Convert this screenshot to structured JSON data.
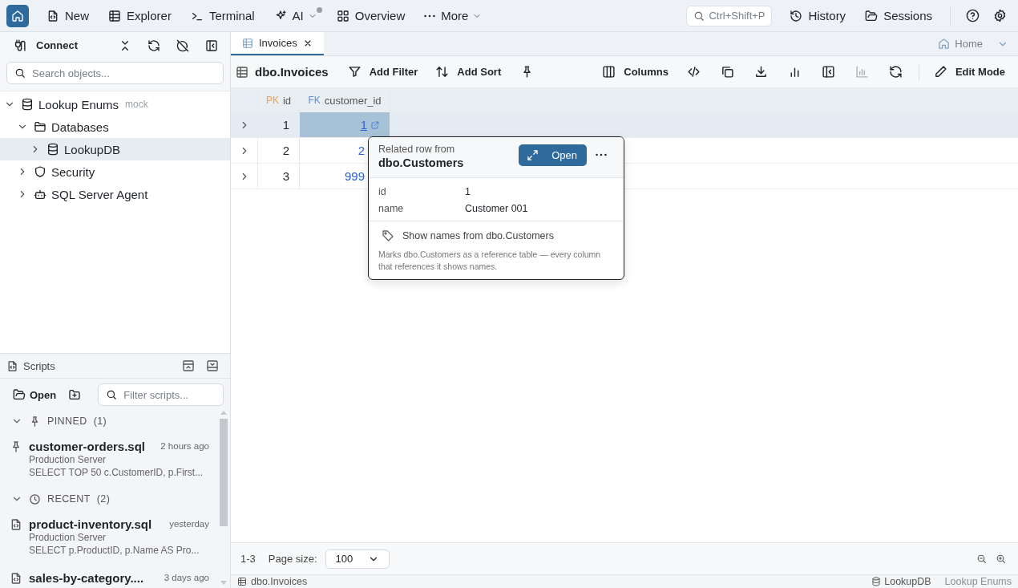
{
  "topbar": {
    "nav": [
      {
        "kind": "new",
        "label": "New",
        "menu": false,
        "notification": false
      },
      {
        "kind": "explorer",
        "label": "Explorer",
        "menu": false,
        "notification": false
      },
      {
        "kind": "terminal",
        "label": "Terminal",
        "menu": false,
        "notification": false
      },
      {
        "kind": "ai",
        "label": "AI",
        "menu": true,
        "notification": true
      },
      {
        "kind": "overview",
        "label": "Overview",
        "menu": false,
        "notification": false
      },
      {
        "kind": "more",
        "label": "More",
        "menu": true,
        "notification": false
      }
    ],
    "command_search": {
      "placeholder": "Ctrl+Shift+P"
    },
    "actions": [
      {
        "kind": "history",
        "label": "History"
      },
      {
        "kind": "sessions",
        "label": "Sessions"
      }
    ]
  },
  "sidebar": {
    "title": "Connect",
    "search": {
      "placeholder": "Search objects..."
    },
    "tree": [
      {
        "kind": "server",
        "label": "Lookup Enums",
        "badge": "mock",
        "expanded": true,
        "selected": false,
        "children": [
          {
            "kind": "folder",
            "label": "Databases",
            "expanded": true,
            "selected": false,
            "children": [
              {
                "kind": "database",
                "label": "LookupDB",
                "expanded": false,
                "selected": true
              }
            ]
          },
          {
            "kind": "security",
            "label": "Security",
            "expanded": false,
            "selected": false
          },
          {
            "kind": "agent",
            "label": "SQL Server Agent",
            "expanded": false,
            "selected": false
          }
        ]
      }
    ]
  },
  "scripts": {
    "title": "Scripts",
    "open_label": "Open",
    "filter": {
      "placeholder": "Filter scripts..."
    },
    "groups": [
      {
        "kind": "pinned",
        "label": "PINNED",
        "count": "(1)",
        "expanded": true,
        "items": [
          {
            "kind": "pinned",
            "name": "customer-orders.sql",
            "time": "2 hours ago",
            "server": "Production Server",
            "query": "SELECT TOP 50 c.CustomerID, p.First..."
          }
        ]
      },
      {
        "kind": "recent",
        "label": "RECENT",
        "count": "(2)",
        "expanded": true,
        "items": [
          {
            "kind": "script",
            "name": "product-inventory.sql",
            "time": "yesterday",
            "server": "Production Server",
            "query": "SELECT p.ProductID, p.Name AS Pro..."
          },
          {
            "kind": "script",
            "name": "sales-by-category....",
            "time": "3 days ago"
          }
        ]
      }
    ]
  },
  "tabs": [
    {
      "label": "Invoices",
      "selected": true
    }
  ],
  "workspace": {
    "label": "Home"
  },
  "toolbar": {
    "table": "dbo.Invoices",
    "actions": [
      {
        "kind": "filter",
        "label": "Add Filter"
      },
      {
        "kind": "sort",
        "label": "Add Sort"
      },
      {
        "kind": "pin"
      }
    ],
    "tools": [
      {
        "kind": "columns",
        "label": "Columns",
        "disabled": false
      },
      {
        "kind": "code",
        "disabled": false
      },
      {
        "kind": "copy",
        "disabled": false
      },
      {
        "kind": "download",
        "disabled": false
      },
      {
        "kind": "bars",
        "disabled": false
      },
      {
        "kind": "panel",
        "disabled": false
      },
      {
        "kind": "chart",
        "disabled": true
      },
      {
        "kind": "refresh",
        "disabled": false
      }
    ],
    "edit_label": "Edit Mode"
  },
  "grid": {
    "columns": [
      {
        "key_type": "PK",
        "name": "id"
      },
      {
        "key_type": "FK",
        "name": "customer_id"
      }
    ],
    "rows": [
      {
        "selected": true,
        "cell_active": true,
        "id": "1",
        "customer_id": "1"
      },
      {
        "selected": false,
        "cell_active": false,
        "id": "2",
        "customer_id": "2"
      },
      {
        "selected": false,
        "cell_active": false,
        "id": "3",
        "customer_id": "999"
      }
    ]
  },
  "popover": {
    "caption": "Related row from",
    "table": "dbo.Customers",
    "open_label": "Open",
    "fields": [
      {
        "name": "id",
        "value": "1"
      },
      {
        "name": "name",
        "value": "Customer 001"
      }
    ],
    "action": "Show names from dbo.Customers",
    "note": "Marks dbo.Customers as a reference table — every column that references it shows names."
  },
  "footer": {
    "range": "1-3",
    "page_size_label": "Page size:",
    "page_size": "100"
  },
  "status": {
    "table": "dbo.Invoices",
    "database": "LookupDB",
    "connection": "Lookup Enums"
  }
}
